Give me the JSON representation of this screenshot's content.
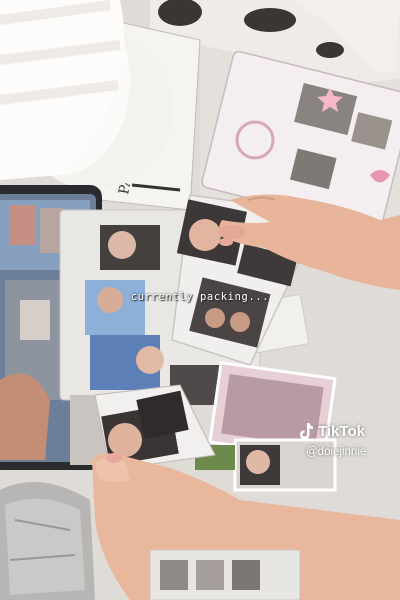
{
  "video": {
    "caption": "currently packing...",
    "watermark_brand": "TikTok",
    "watermark_handle": "@doiejinnie"
  },
  "scene_objects": [
    "lamp",
    "tablet",
    "photocard-stack",
    "hands",
    "binder-sleeves",
    "packing-bags"
  ],
  "colors": {
    "desk": "#dedbd7",
    "skin": "#e9b79c",
    "nail": "#e8a8a0",
    "watermark": "#ffffff"
  }
}
